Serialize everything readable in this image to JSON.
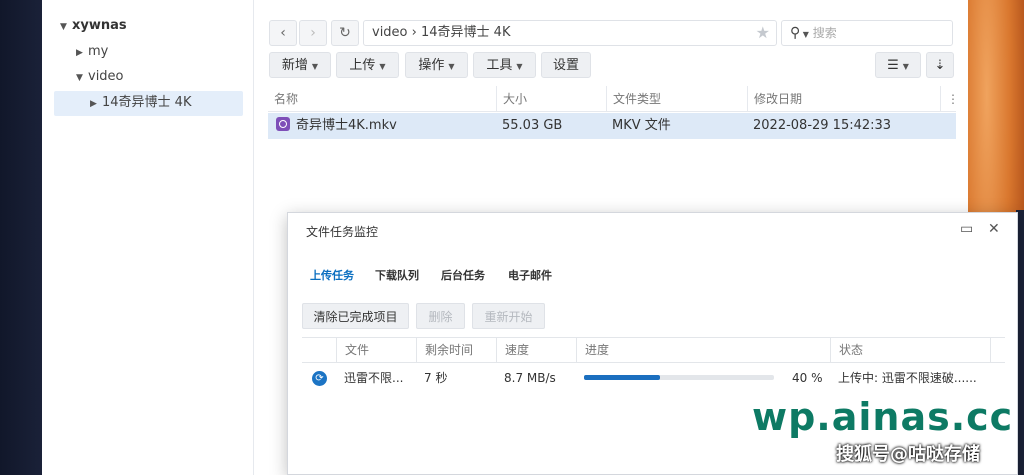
{
  "sidebar": {
    "root": "xywnas",
    "items": [
      "my",
      "video"
    ],
    "selected": "14奇异博士 4K"
  },
  "toolbar": {
    "path_root": "video",
    "path_sep": "›",
    "path_folder": "14奇异博士 4K",
    "search_placeholder": "搜索",
    "buttons": [
      "新增",
      "上传",
      "操作",
      "工具",
      "设置"
    ]
  },
  "files": {
    "headers": [
      "名称",
      "大小",
      "文件类型",
      "修改日期"
    ],
    "rows": [
      {
        "name": "奇异博士4K.mkv",
        "size": "55.03 GB",
        "type": "MKV 文件",
        "modified": "2022-08-29 15:42:33"
      }
    ]
  },
  "monitor": {
    "title": "文件任务监控",
    "tabs": [
      "上传任务",
      "下载队列",
      "后台任务",
      "电子邮件"
    ],
    "buttons": [
      "清除已完成项目",
      "删除",
      "重新开始"
    ],
    "headers": [
      "文件",
      "剩余时间",
      "速度",
      "进度",
      "状态"
    ],
    "task": {
      "file": "迅雷不限...",
      "remaining": "7 秒",
      "speed": "8.7 MB/s",
      "progress": 40,
      "progress_text": "40 %",
      "status": "上传中: 迅雷不限速破......"
    }
  },
  "watermark": {
    "site": "wp.ainas.cc",
    "source": "搜狐号@咕哒存储"
  }
}
